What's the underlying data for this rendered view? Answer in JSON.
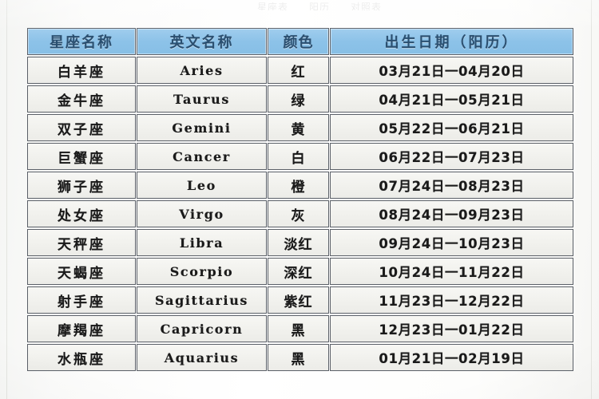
{
  "document": {
    "top_faint_fragments": [
      "星座表",
      "阳历",
      "对照表"
    ]
  },
  "table": {
    "headers": {
      "name": "星座名称",
      "english": "英文名称",
      "color": "颜色",
      "date": "出生日期（阳历）"
    },
    "header_bg_color": "#8cc2e8",
    "header_text_color": "#2a4f70",
    "cell_bg_color": "#f2f2ee",
    "border_color": "#5b6068",
    "rows": [
      {
        "name": "白羊座",
        "english": "Aries",
        "color": "红",
        "date": "03月21日一04月20日"
      },
      {
        "name": "金牛座",
        "english": "Taurus",
        "color": "绿",
        "date": "04月21日一05月21日"
      },
      {
        "name": "双子座",
        "english": "Gemini",
        "color": "黄",
        "date": "05月22日一06月21日"
      },
      {
        "name": "巨蟹座",
        "english": "Cancer",
        "color": "白",
        "date": "06月22日一07月23日"
      },
      {
        "name": "狮子座",
        "english": "Leo",
        "color": "橙",
        "date": "07月24日一08月23日"
      },
      {
        "name": "处女座",
        "english": "Virgo",
        "color": "灰",
        "date": "08月24日一09月23日"
      },
      {
        "name": "天秤座",
        "english": "Libra",
        "color": "淡红",
        "date": "09月24日一10月23日"
      },
      {
        "name": "天蝎座",
        "english": "Scorpio",
        "color": "深红",
        "date": "10月24日一11月22日"
      },
      {
        "name": "射手座",
        "english": "Sagittarius",
        "color": "紫红",
        "date": "11月23日一12月22日"
      },
      {
        "name": "摩羯座",
        "english": "Capricorn",
        "color": "黑",
        "date": "12月23日一01月22日"
      },
      {
        "name": "水瓶座",
        "english": "Aquarius",
        "color": "黑",
        "date": "01月21日一02月19日"
      }
    ]
  }
}
